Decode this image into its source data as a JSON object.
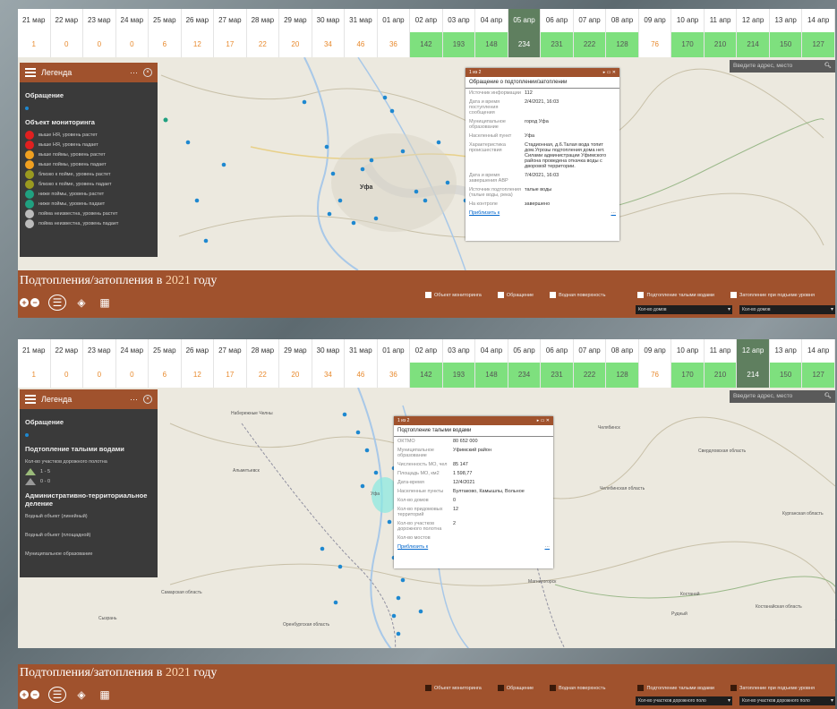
{
  "timeline": {
    "days": [
      "21 мар",
      "22 мар",
      "23 мар",
      "24 мар",
      "25 мар",
      "26 мар",
      "27 мар",
      "28 мар",
      "29 мар",
      "30 мар",
      "31 мар",
      "01 апр",
      "02 апр",
      "03 апр",
      "04 апр",
      "05 апр",
      "06 апр",
      "07 апр",
      "08 апр",
      "09 апр",
      "10 апр",
      "11 апр",
      "12 апр",
      "13 апр",
      "14 апр"
    ],
    "values": [
      "1",
      "0",
      "0",
      "0",
      "6",
      "12",
      "17",
      "22",
      "20",
      "34",
      "46",
      "36",
      "142",
      "193",
      "148",
      "234",
      "231",
      "222",
      "128",
      "76",
      "170",
      "210",
      "214",
      "150",
      "127"
    ]
  },
  "app": {
    "title_prefix": "Подтопления/затопления в ",
    "title_year": "2021",
    "title_suffix": " году"
  },
  "controls": {
    "zoom_in": "+",
    "zoom_out": "−"
  },
  "legend": {
    "title": "Легенда",
    "more": "···",
    "close": "×",
    "panel1": {
      "sec1": "Обращение",
      "sec2": "Объект мониторинга",
      "items": [
        {
          "label": "выше НЯ, уровень растет",
          "color": "#e02020"
        },
        {
          "label": "выше НЯ, уровень падает",
          "color": "#e02020"
        },
        {
          "label": "выше поймы, уровень растет",
          "color": "#f0a020"
        },
        {
          "label": "выше поймы, уровень падает",
          "color": "#f0a020"
        },
        {
          "label": "близко к пойме, уровень растет",
          "color": "#9a9a20"
        },
        {
          "label": "близко к пойме, уровень падает",
          "color": "#9a9a20"
        },
        {
          "label": "ниже поймы, уровень растет",
          "color": "#20a080"
        },
        {
          "label": "ниже поймы, уровень падает",
          "color": "#20a080"
        },
        {
          "label": "пойма неизвестна, уровень растет",
          "color": "#bbbbbb"
        },
        {
          "label": "пойма неизвестна, уровень падает",
          "color": "#bbbbbb"
        }
      ]
    },
    "panel2": {
      "sec1": "Обращение",
      "sec2": "Подтопление талыми водами",
      "sub": "Кол-во участков дорожного полотна",
      "r1": "1 - 5",
      "r2": "0 - 0",
      "sec3": "Административно-территориальное деление",
      "i1": "Водный объект (линейный)",
      "i2": "Водный объект (площадной)",
      "i3": "Муниципальное образование"
    }
  },
  "layers": [
    "Объект мониторинга",
    "Обращение",
    "Водная поверхность",
    "Подтопление талыми водами",
    "Затопление при подъеме уровня"
  ],
  "selects": {
    "p1a": "Кол-во домов",
    "p1b": "Кол-во домов",
    "p2a": "Кол-во участков дорожного поло",
    "p2b": "Кол-во участков дорожного поло"
  },
  "search": {
    "placeholder": "Введите адрес, место"
  },
  "popup1": {
    "counter": "1 из 2",
    "controls": "▸  ▭ ✕",
    "title": "Обращение о подтоплении/затоплении",
    "rows": [
      {
        "k": "Источник информации",
        "v": "112"
      },
      {
        "k": "Дата и время поступления сообщения",
        "v": "2/4/2021, 16:03"
      },
      {
        "k": "Муниципальное образование",
        "v": "город Уфа"
      },
      {
        "k": "Населенный пункт",
        "v": "Уфа"
      },
      {
        "k": "Характеристика происшествия",
        "v": "Стадионная, д.6.Талая вода топит дом.Угрозы подтопления дома нет. Силами администрации Уфимского района проведена откачка воды с дворовой территории."
      },
      {
        "k": "Дата и время завершения АВР",
        "v": "7/4/2021, 16:03"
      },
      {
        "k": "Источник подтопления (талые воды, река)",
        "v": "талые воды"
      },
      {
        "k": "На контроле",
        "v": "завершено"
      }
    ],
    "zoom": "Приблизить к",
    "more": "···"
  },
  "popup2": {
    "counter": "1 из 2",
    "controls": "▸  ▭ ✕",
    "title": "Подтопление талыми водами",
    "rows": [
      {
        "k": "ОКТМО",
        "v": "80 652 000"
      },
      {
        "k": "Муниципальное образование",
        "v": "Уфимский район"
      },
      {
        "k": "Численность МО, чел",
        "v": "85 147"
      },
      {
        "k": "Площадь МО, км2",
        "v": "1 598,77"
      },
      {
        "k": "Дата-время",
        "v": "12/4/2021"
      },
      {
        "k": "Населенные пункты",
        "v": "Бултаково, Камышлы, Вольное"
      },
      {
        "k": "Кол-во домов",
        "v": "0"
      },
      {
        "k": "Кол-во придомовых территорий",
        "v": "12"
      },
      {
        "k": "Кол-во участков дорожного полотна",
        "v": "2"
      },
      {
        "k": "Кол-во мостов",
        "v": ""
      }
    ],
    "zoom": "Приблизить к",
    "more": "···"
  },
  "map_labels": {
    "ufa1": "Уфа",
    "ufa2": "Уфа",
    "naberezhnye": "Набережные Челны",
    "chelyabinsk": "Челябинск",
    "magnitogorsk": "Магнитогорск",
    "kostanay": "Костанай",
    "rudny": "Рудный",
    "almetyevsk": "Альметьевск",
    "syzran": "Сызрань",
    "sverdlovsk": "Свердловская область",
    "chelyab_obl": "Челябинская область",
    "samara_obl": "Самарская область",
    "orenburg_obl": "Оренбургская область",
    "kostanay_obl": "Костанайская область",
    "kurgan_obl": "Курганская область"
  },
  "colors": {
    "accent": "#a0522d",
    "selected_day": "#5f7f5f",
    "highlight": "#7ee07e",
    "point": "#1e88d0"
  }
}
